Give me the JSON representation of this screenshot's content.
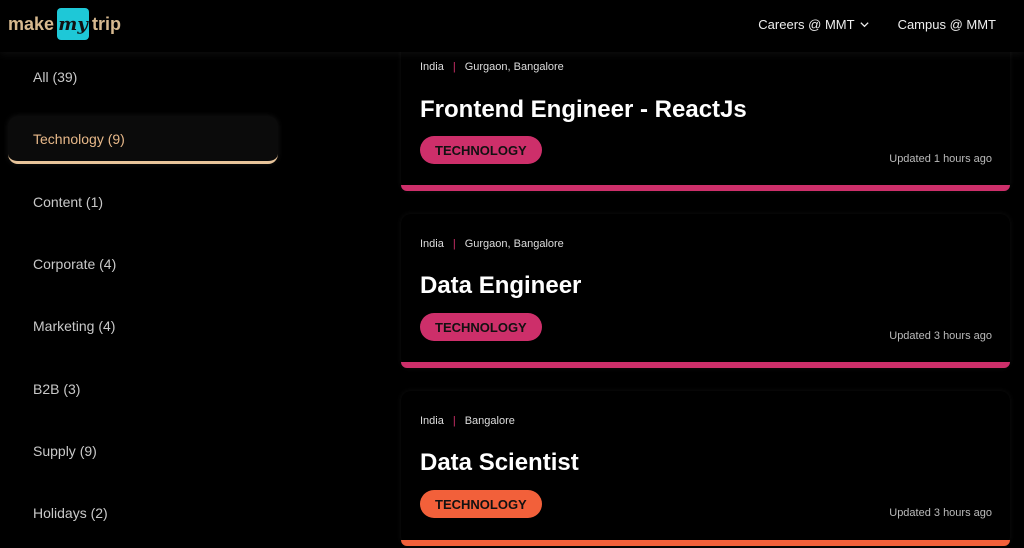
{
  "header": {
    "logo": {
      "pre": "make",
      "mid": "my",
      "post": "trip"
    },
    "nav": [
      {
        "label": "Careers @ MMT"
      },
      {
        "label": "Campus @ MMT"
      }
    ]
  },
  "sidebar": {
    "items": [
      {
        "label": "All (39)"
      },
      {
        "label": "Technology (9)"
      },
      {
        "label": "Content (1)"
      },
      {
        "label": "Corporate (4)"
      },
      {
        "label": "Marketing (4)"
      },
      {
        "label": "B2B (3)"
      },
      {
        "label": "Supply (9)"
      },
      {
        "label": "Holidays (2)"
      }
    ],
    "active_index": 1
  },
  "jobs": [
    {
      "country": "India",
      "cities": "Gurgaon, Bangalore",
      "title": "Frontend Engineer - ReactJs",
      "tag": "TECHNOLOGY",
      "updated": "Updated 1 hours ago",
      "accent": "#cd2f6a"
    },
    {
      "country": "India",
      "cities": "Gurgaon, Bangalore",
      "title": "Data Engineer",
      "tag": "TECHNOLOGY",
      "updated": "Updated 3 hours ago",
      "accent": "#cd2f6a"
    },
    {
      "country": "India",
      "cities": "Bangalore",
      "title": "Data Scientist",
      "tag": "TECHNOLOGY",
      "updated": "Updated 3 hours ago",
      "accent": "#f2603a"
    }
  ],
  "colors": {
    "active_category": "#e8b98a",
    "logo_box": "#1ec8d7",
    "logo_text": "#d7b98f"
  }
}
